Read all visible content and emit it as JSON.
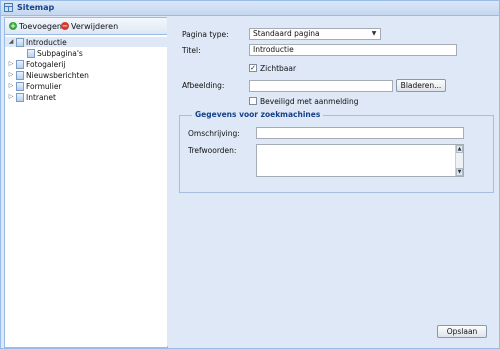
{
  "window": {
    "title": "Sitemap"
  },
  "toolbar": {
    "add_label": "Toevoegen",
    "delete_label": "Verwijderen"
  },
  "tree": {
    "nodes": [
      {
        "label": "Introductie",
        "expanded": true,
        "selected": true
      },
      {
        "label": "Subpagina's"
      },
      {
        "label": "Fotogalerij",
        "expanded": false
      },
      {
        "label": "Nieuwsberichten",
        "expanded": false
      },
      {
        "label": "Formulier",
        "expanded": false
      },
      {
        "label": "Intranet",
        "expanded": false
      }
    ]
  },
  "form": {
    "page_type_label": "Pagina type:",
    "page_type_value": "Standaard pagina",
    "title_label": "Titel:",
    "title_value": "Introductie",
    "visible_label": "Zichtbaar",
    "visible_checked": true,
    "image_label": "Afbeelding:",
    "image_value": "",
    "browse_label": "Bladeren...",
    "secured_label": "Beveiligd met aanmelding",
    "secured_checked": false,
    "seo_legend": "Gegevens voor zoekmachines",
    "description_label": "Omschrijving:",
    "description_value": "",
    "keywords_label": "Trefwoorden:",
    "keywords_value": "",
    "save_label": "Opslaan"
  },
  "colors": {
    "accent": "#15428b",
    "panel_bg": "#dfe8f6",
    "border": "#99bbe8"
  }
}
